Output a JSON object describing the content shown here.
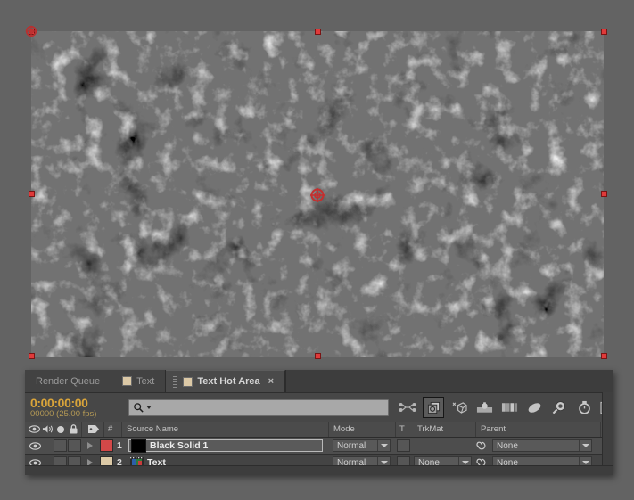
{
  "app": "Adobe After Effects",
  "viewer": {
    "name": "composition-viewer",
    "layer_selected": "Black Solid 1",
    "anchor_point_color": "#c42f2f",
    "handle_color": "#e03a3a",
    "canvas_background": "#000000",
    "content_description": "fractal noise black and white"
  },
  "tabs": [
    {
      "label": "Render Queue",
      "active": false,
      "has_swatch": false,
      "closable": false
    },
    {
      "label": "Text",
      "active": false,
      "has_swatch": true,
      "closable": false
    },
    {
      "label": "Text Hot Area",
      "active": true,
      "has_swatch": true,
      "closable": true,
      "close_label": "×"
    }
  ],
  "toolbar": {
    "timecode": "0:00:00:00",
    "timecode_sub": "00000 (25.00 fps)",
    "timecode_color": "#d9a43a",
    "search_value": "",
    "search_placeholder": "",
    "icons": [
      {
        "name": "composition-mini-flowchart-icon",
        "active": false
      },
      {
        "name": "draft-3d-icon",
        "active": true
      },
      {
        "name": "motion-blur-switch-icon",
        "active": false
      },
      {
        "name": "hide-shy-layers-icon",
        "active": false
      },
      {
        "name": "frame-blending-icon",
        "active": false
      },
      {
        "name": "motion-blur-icon",
        "active": false
      },
      {
        "name": "brainstorm-icon",
        "active": false
      },
      {
        "name": "auto-keyframe-icon",
        "active": false
      },
      {
        "name": "graph-editor-icon",
        "active": false
      }
    ]
  },
  "columns": {
    "switch_icons": [
      "eye-icon",
      "audio-icon",
      "solo-icon",
      "lock-icon"
    ],
    "label_icon": "label-tag-icon",
    "index": "#",
    "source_name": "Source Name",
    "mode": "Mode",
    "t": "T",
    "trkmat": "TrkMat",
    "parent": "Parent"
  },
  "layers": [
    {
      "index": "1",
      "name": "Black Solid 1",
      "selected": true,
      "visible": true,
      "label_color": "#d24848",
      "thumbnail": "black-solid-thumbnail",
      "mode": "Normal",
      "trkmat": "",
      "trkmat_visible": false,
      "parent": "None"
    },
    {
      "index": "2",
      "name": "Text",
      "selected": false,
      "visible": true,
      "label_color": "#dcc9a6",
      "thumbnail": "text-layer-thumbnail",
      "mode": "Normal",
      "trkmat": "None",
      "trkmat_visible": true,
      "parent": "None"
    }
  ],
  "colors": {
    "panel_bg": "#3a3a3a",
    "app_bg": "#636363",
    "row_odd": "#4d4d4d",
    "row_even": "#444444",
    "text": "#d6d6d6",
    "accent_amber": "#d9a43a"
  }
}
